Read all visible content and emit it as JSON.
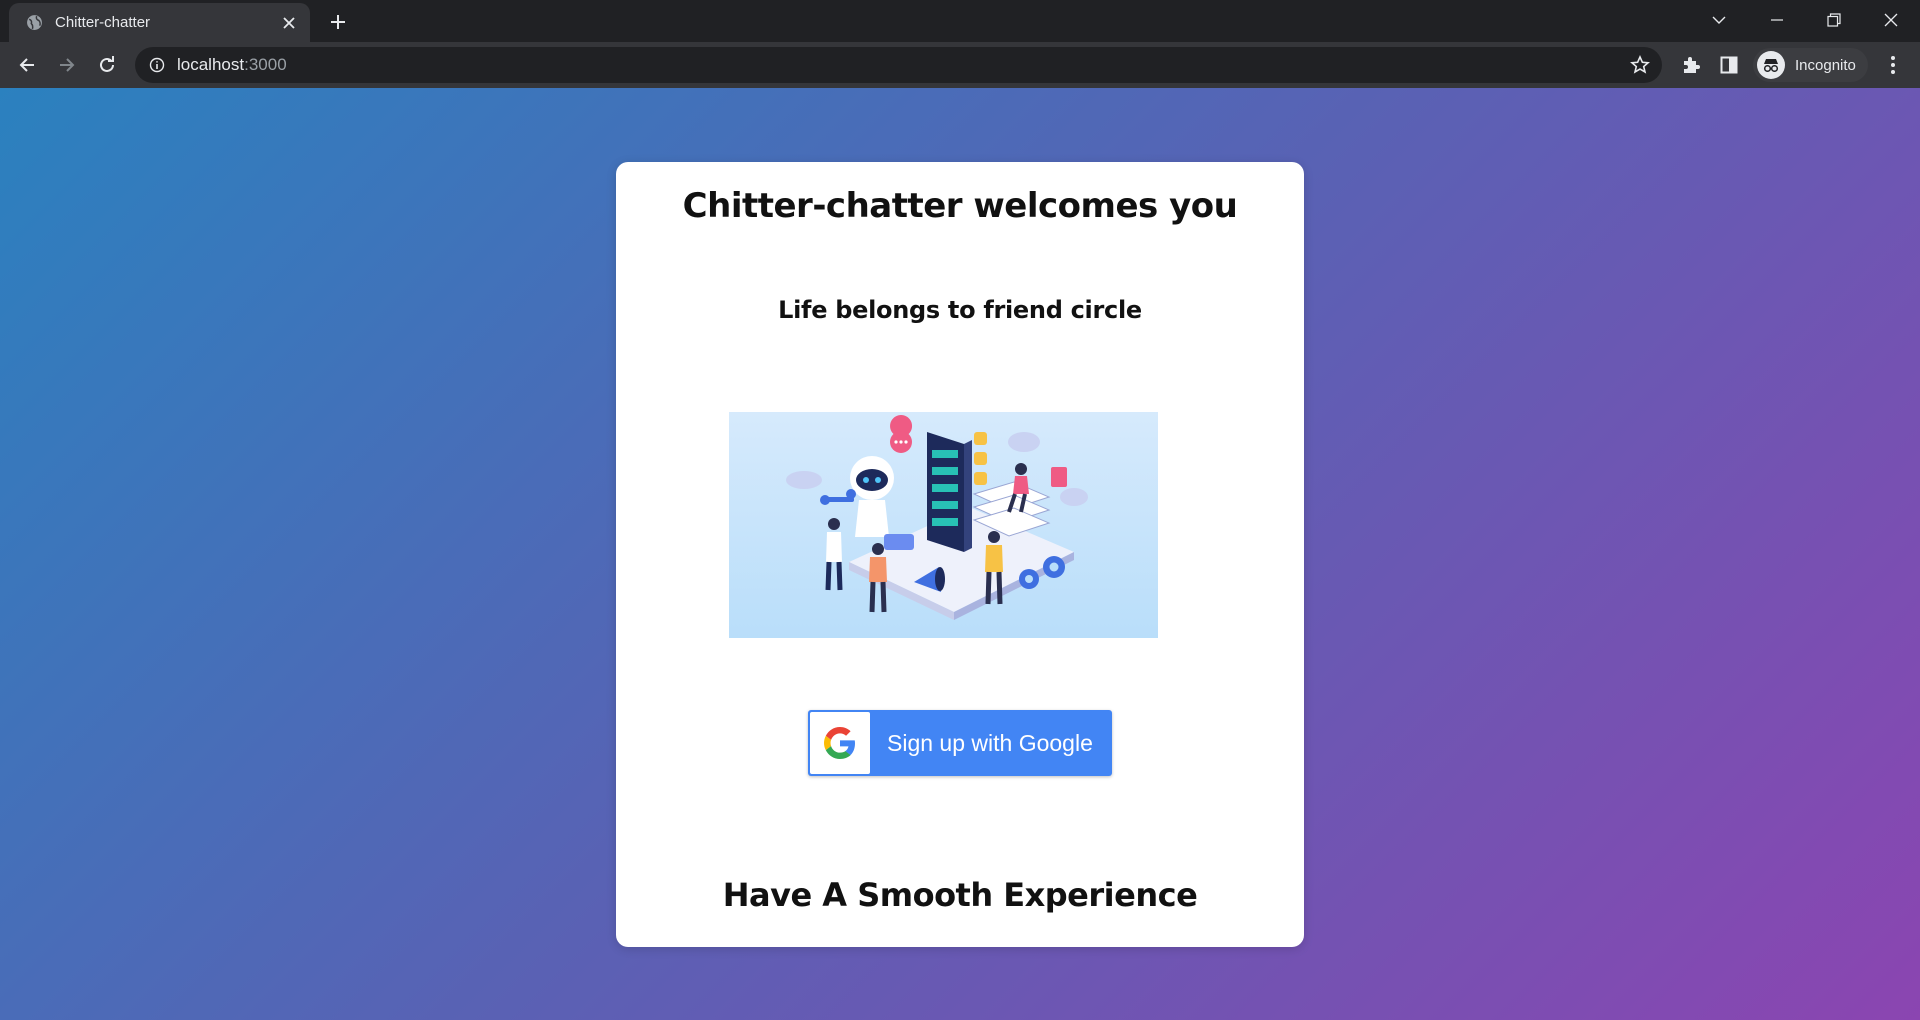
{
  "browser": {
    "tab": {
      "title": "Chitter-chatter",
      "favicon": "globe-icon"
    },
    "url": {
      "host": "localhost",
      "port": ":3000"
    },
    "profile": {
      "label": "Incognito",
      "icon": "incognito-icon"
    }
  },
  "page": {
    "heading": "Chitter-chatter welcomes you",
    "tagline": "Life belongs to friend circle",
    "illustration": "chatbot-illustration",
    "signup_button": {
      "label": "Sign up with Google",
      "icon": "google-icon"
    },
    "footer": "Have A Smooth Experience"
  },
  "colors": {
    "gradient_start": "#2b81bf",
    "gradient_end": "#8b45b1",
    "google_blue": "#4285f4",
    "card": "#ffffff"
  }
}
